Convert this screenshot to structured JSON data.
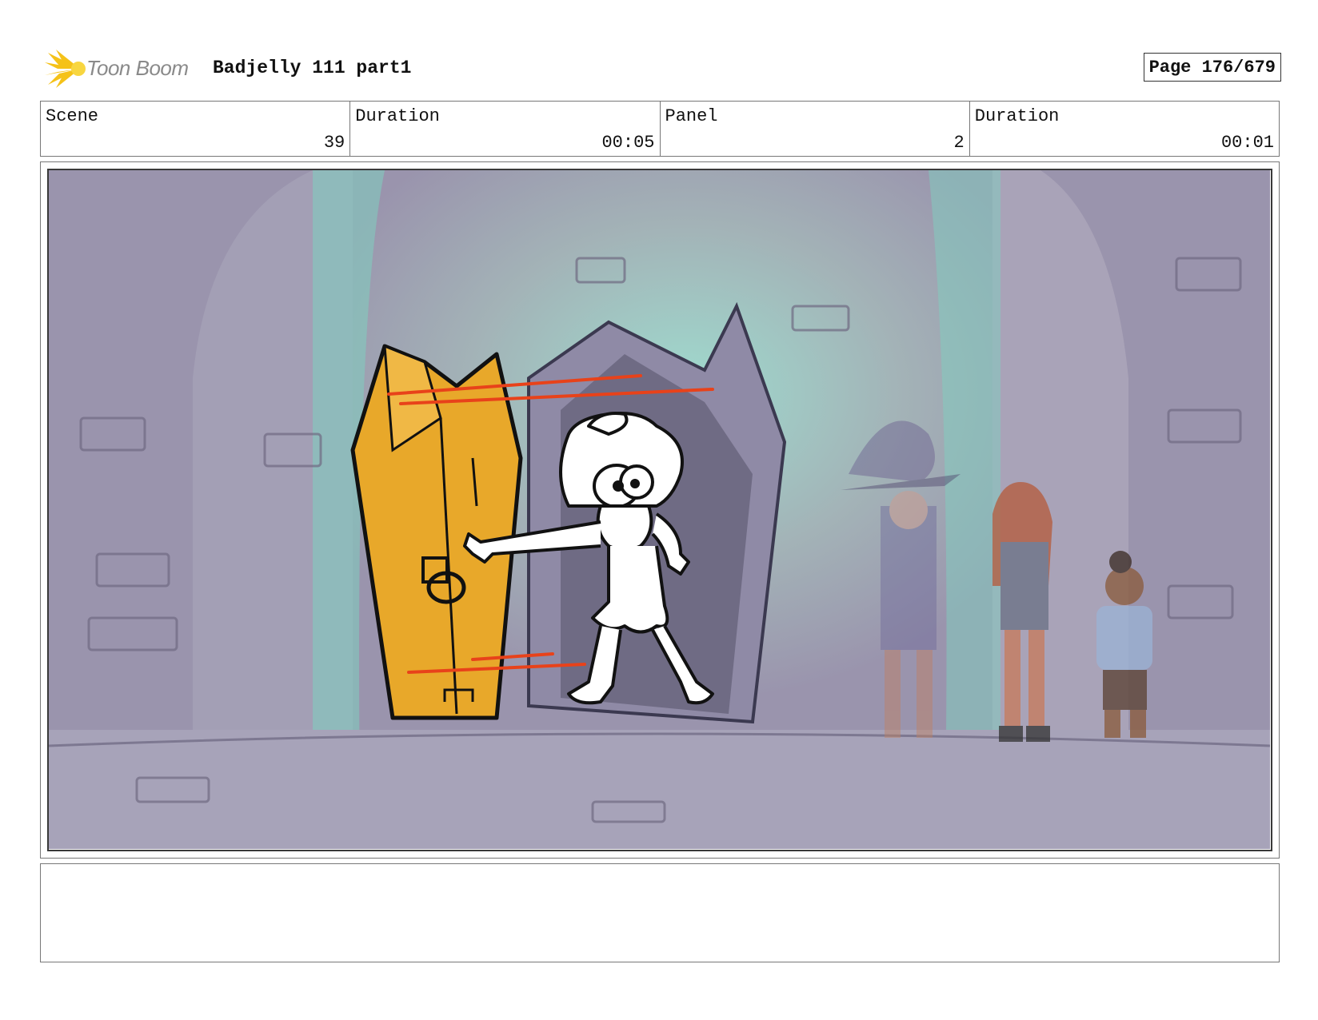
{
  "header": {
    "logo_text": "Toon Boom",
    "title": "Badjelly 111 part1",
    "page_label": "Page 176/679"
  },
  "info": [
    {
      "label": "Scene",
      "value": "39"
    },
    {
      "label": "Duration",
      "value": "00:05"
    },
    {
      "label": "Panel",
      "value": "2"
    },
    {
      "label": "Duration",
      "value": "00:01"
    }
  ],
  "panel": {
    "description": ""
  },
  "colors": {
    "logo_yellow": "#f5c218",
    "coffin": "#e8a82a",
    "speed_lines": "#e8421a",
    "background_purple": "#9a94ad",
    "portal_teal": "#7fd6c4"
  }
}
